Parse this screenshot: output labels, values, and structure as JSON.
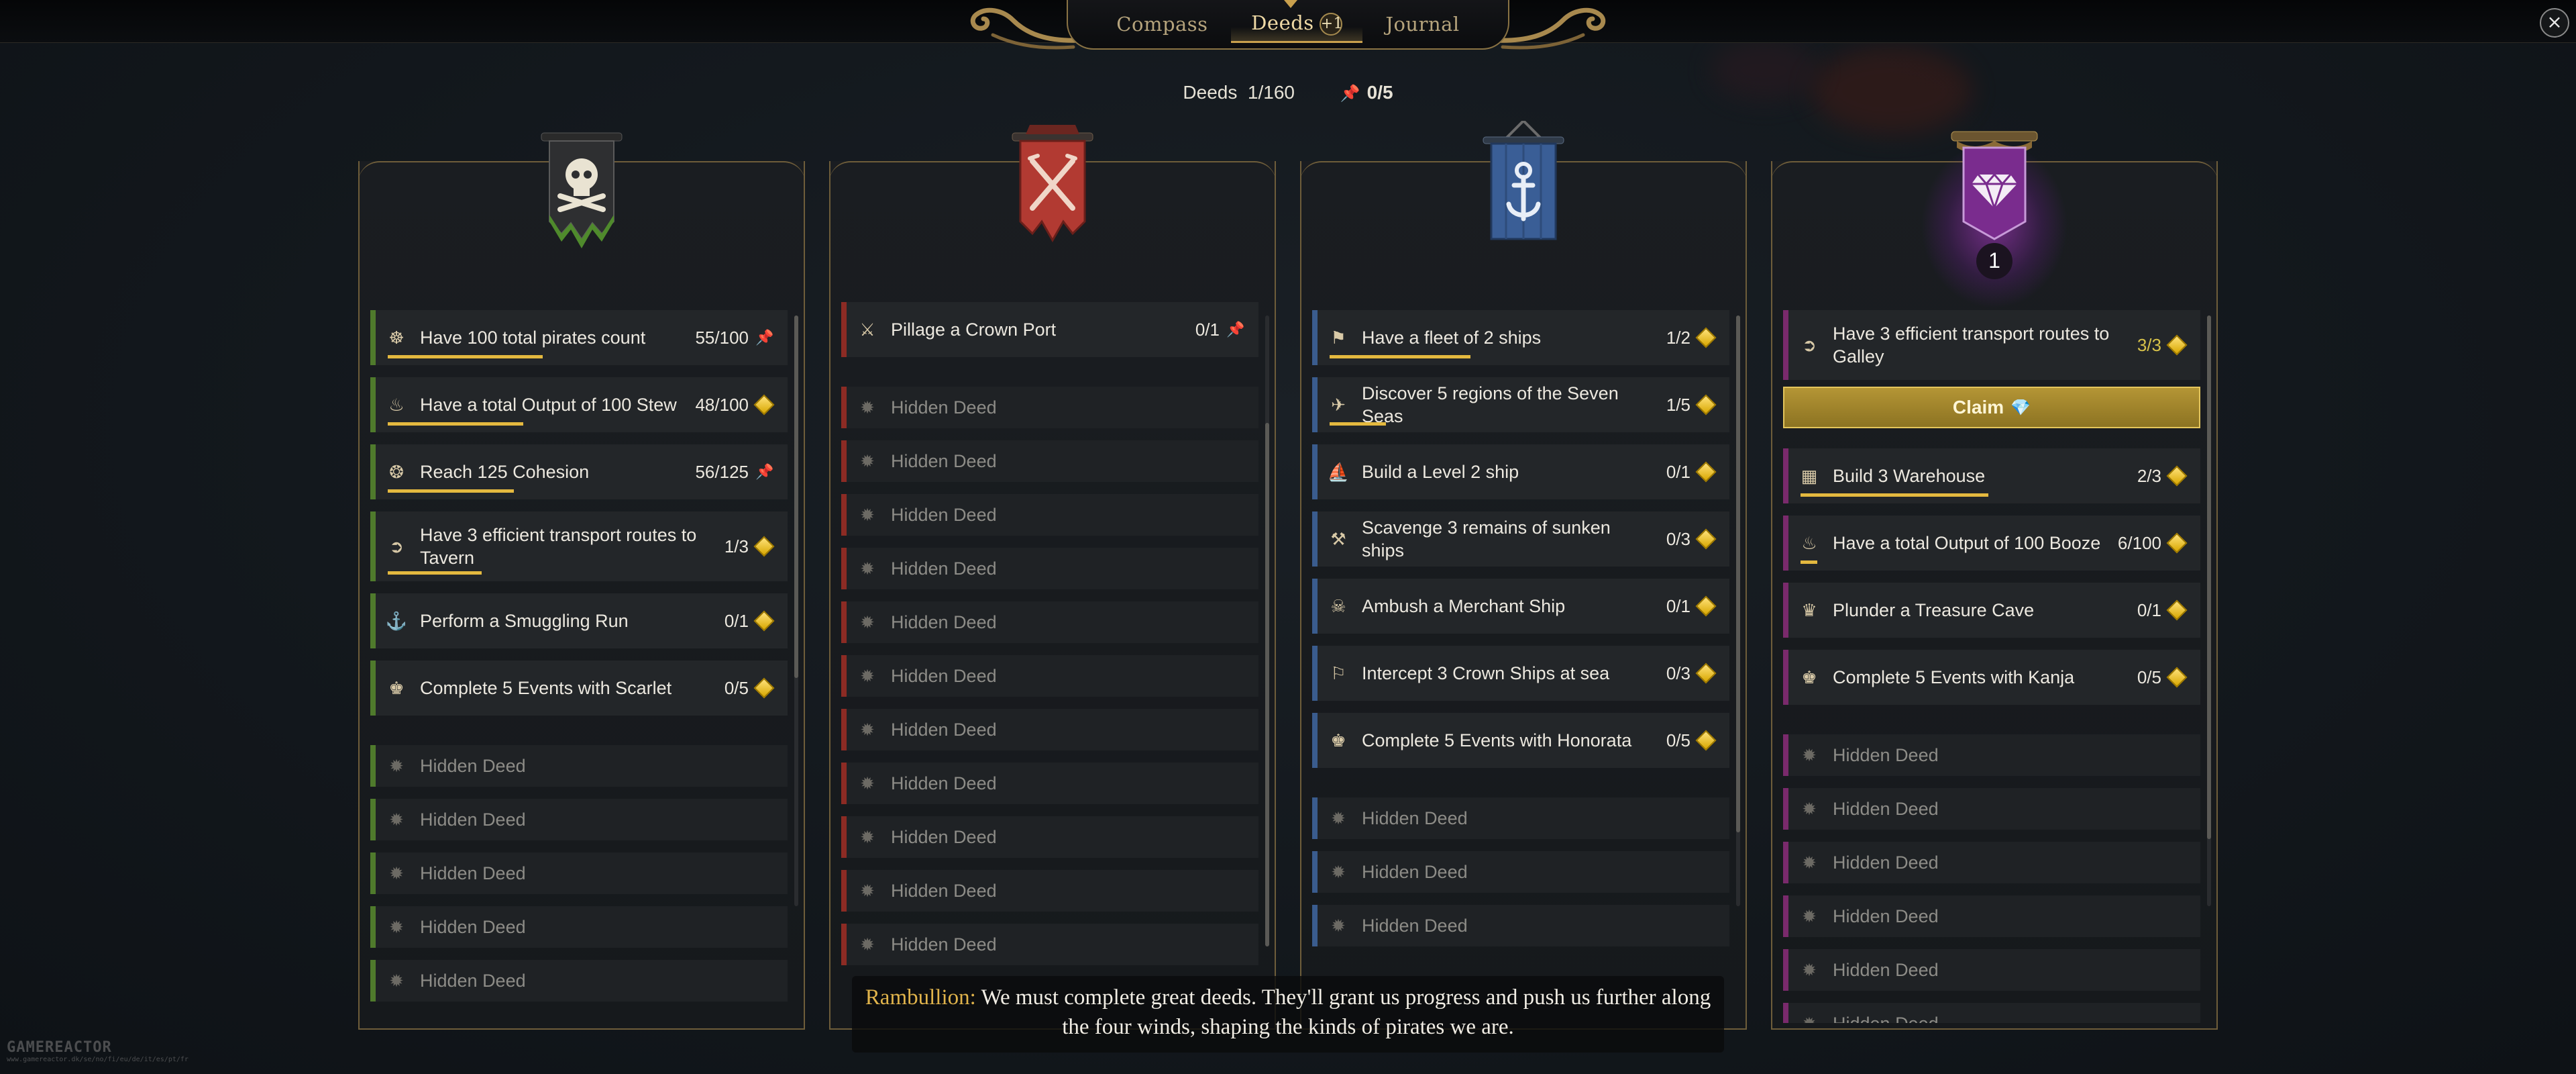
{
  "tabs": [
    {
      "label": "Compass"
    },
    {
      "label": "Deeds",
      "badge": "+1"
    },
    {
      "label": "Journal"
    }
  ],
  "summary": {
    "deeds_label": "Deeds",
    "deeds_count": "1/160",
    "pinned": "0/5"
  },
  "columns": [
    {
      "accent": "#4f7a2c",
      "banner": "skull-banner",
      "items": [
        {
          "title": "Have 100 total pirates count",
          "progress": "55/100",
          "fraction": 0.55,
          "reward": "pin",
          "icon": "crew-icon"
        },
        {
          "title": "Have a total Output of 100 Stew",
          "progress": "48/100",
          "fraction": 0.48,
          "reward": "diamond",
          "icon": "stew-icon"
        },
        {
          "title": "Reach 125 Cohesion",
          "progress": "56/125",
          "fraction": 0.448,
          "reward": "pin",
          "icon": "cohesion-icon"
        },
        {
          "title": "Have 3 efficient transport routes to Tavern",
          "progress": "1/3",
          "fraction": 0.333,
          "reward": "diamond",
          "icon": "route-icon"
        },
        {
          "title": "Perform a Smuggling Run",
          "progress": "0/1",
          "fraction": 0,
          "reward": "diamond",
          "icon": "smuggle-icon"
        },
        {
          "title": "Complete 5 Events with Scarlet",
          "progress": "0/5",
          "fraction": 0,
          "reward": "diamond",
          "icon": "event-icon"
        }
      ],
      "hidden": [
        "Hidden Deed",
        "Hidden Deed",
        "Hidden Deed",
        "Hidden Deed",
        "Hidden Deed"
      ]
    },
    {
      "accent": "#8c2b24",
      "banner": "crossed-swords-banner",
      "items": [
        {
          "title": "Pillage a Crown Port",
          "progress": "0/1",
          "fraction": 0,
          "reward": "pin",
          "icon": "pillage-icon"
        }
      ],
      "hidden": [
        "Hidden Deed",
        "Hidden Deed",
        "Hidden Deed",
        "Hidden Deed",
        "Hidden Deed",
        "Hidden Deed",
        "Hidden Deed",
        "Hidden Deed",
        "Hidden Deed",
        "Hidden Deed",
        "Hidden Deed"
      ]
    },
    {
      "accent": "#3a5c8e",
      "banner": "anchor-banner",
      "items": [
        {
          "title": "Have a fleet of 2 ships",
          "progress": "1/2",
          "fraction": 0.5,
          "reward": "diamond",
          "icon": "fleet-icon"
        },
        {
          "title": "Discover 5 regions of the Seven Seas",
          "progress": "1/5",
          "fraction": 0.2,
          "reward": "diamond",
          "icon": "map-icon"
        },
        {
          "title": "Build a Level 2 ship",
          "progress": "0/1",
          "fraction": 0,
          "reward": "diamond",
          "icon": "ship-icon"
        },
        {
          "title": "Scavenge 3 remains of sunken ships",
          "progress": "0/3",
          "fraction": 0,
          "reward": "diamond",
          "icon": "scavenge-icon"
        },
        {
          "title": "Ambush a Merchant Ship",
          "progress": "0/1",
          "fraction": 0,
          "reward": "diamond",
          "icon": "ambush-icon"
        },
        {
          "title": "Intercept 3 Crown Ships at sea",
          "progress": "0/3",
          "fraction": 0,
          "reward": "diamond",
          "icon": "intercept-icon"
        },
        {
          "title": "Complete 5 Events with Honorata",
          "progress": "0/5",
          "fraction": 0,
          "reward": "diamond",
          "icon": "event-icon"
        }
      ],
      "hidden": [
        "Hidden Deed",
        "Hidden Deed",
        "Hidden Deed"
      ]
    },
    {
      "accent": "#7a2a6c",
      "banner": "gem-banner",
      "banner_count": "1",
      "claim_label": "Claim",
      "items": [
        {
          "title": "Have 3 efficient transport routes to Galley",
          "progress": "3/3",
          "fraction": 1,
          "reward": "diamond",
          "icon": "route-icon",
          "done": true,
          "claim": true
        },
        {
          "title": "Build 3 Warehouse",
          "progress": "2/3",
          "fraction": 0.667,
          "reward": "diamond",
          "icon": "warehouse-icon"
        },
        {
          "title": "Have a total Output of 100 Booze",
          "progress": "6/100",
          "fraction": 0.06,
          "reward": "diamond",
          "icon": "booze-icon"
        },
        {
          "title": "Plunder a Treasure Cave",
          "progress": "0/1",
          "fraction": 0,
          "reward": "diamond",
          "icon": "treasure-icon"
        },
        {
          "title": "Complete 5 Events with Kanja",
          "progress": "0/5",
          "fraction": 0,
          "reward": "diamond",
          "icon": "event-icon"
        }
      ],
      "hidden": [
        "Hidden Deed",
        "Hidden Deed",
        "Hidden Deed",
        "Hidden Deed",
        "Hidden Deed",
        "Hidden Deed"
      ]
    }
  ],
  "dialogue": {
    "speaker": "Rambullion:",
    "text": "We must complete great deeds. They'll grant us progress and push us further along the four winds, shaping the kinds of pirates we are."
  },
  "watermark": {
    "brand": "GAMEREACTOR",
    "url": "www.gamereactor.dk/se/no/fi/eu/de/it/es/pt/fr"
  }
}
